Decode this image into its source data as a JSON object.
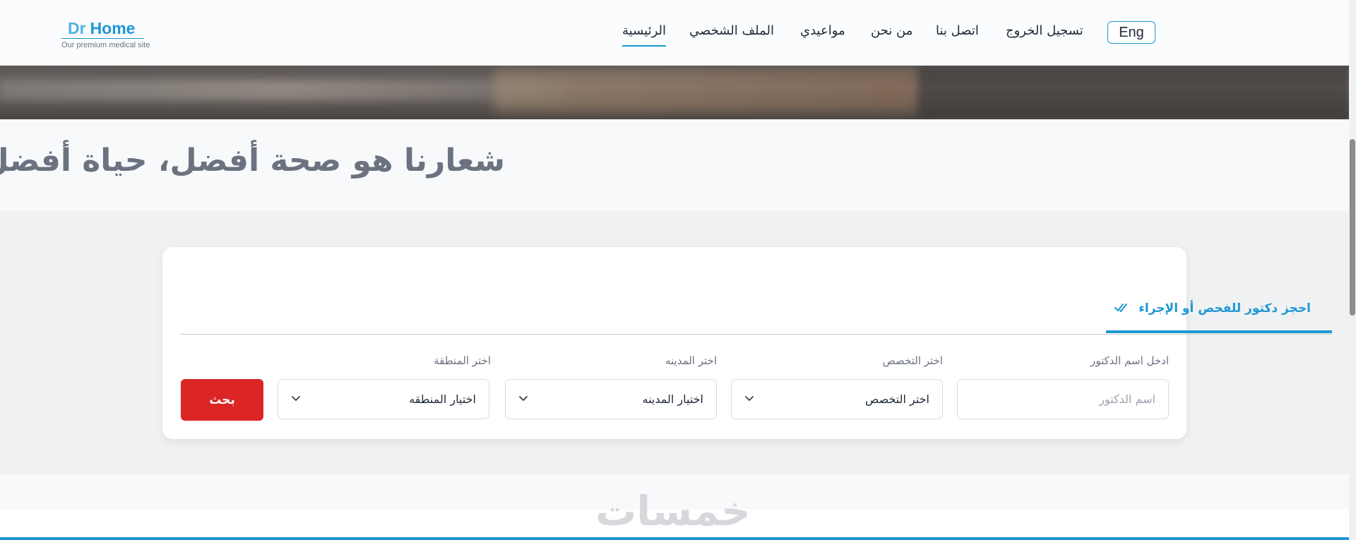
{
  "logo": {
    "brand_prefix": "Dr",
    "brand_name": "Home",
    "tagline": "Our premium medical site"
  },
  "nav": {
    "home": "الرئيسية",
    "profile": "الملف الشخصي",
    "appointments": "مواعيدي",
    "about": "من نحن",
    "contact": "اتصل بنا",
    "logout": "تسجيل الخروج",
    "language": "Eng"
  },
  "slogan": "شعارنا هو صحة أفضل، حياة أفضل",
  "search": {
    "tab_label": "احجز دكتور للفحص أو الإجراء",
    "doctor": {
      "label": "ادخل اسم الدكتور",
      "placeholder": "اسم الدكتور"
    },
    "specialty": {
      "label": "اختر التخصص",
      "value": "اختر التخصص"
    },
    "city": {
      "label": "اختر المدينه",
      "value": "اختيار المدينه"
    },
    "area": {
      "label": "اختر المنطقة",
      "value": "اختيار المنطقه"
    },
    "button": "بحث"
  },
  "watermark": "خمسات",
  "colors": {
    "accent": "#1e97d4",
    "danger": "#dc2626"
  }
}
